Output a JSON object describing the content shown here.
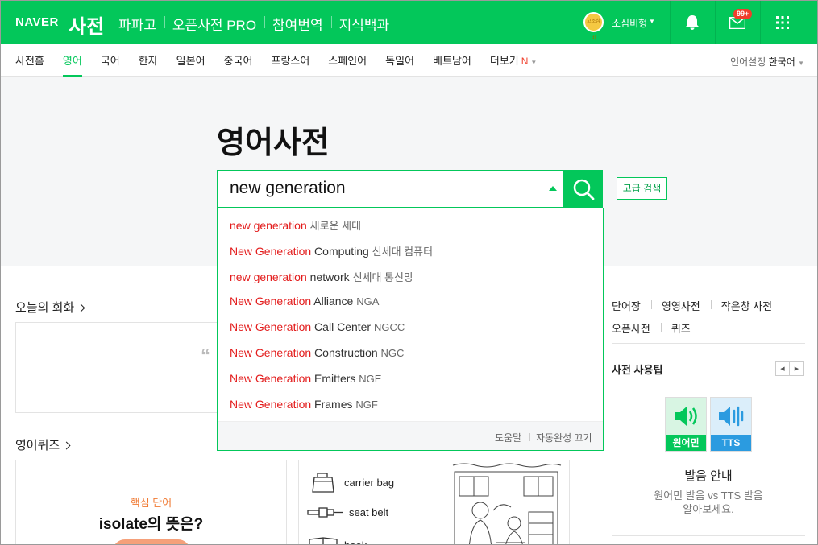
{
  "header": {
    "naver": "NAVER",
    "service": "사전",
    "nav": [
      "파파고",
      "오픈사전 PRO",
      "참여번역",
      "지식백과"
    ],
    "avatar_text": "고소심비",
    "username": "소심비형",
    "mail_badge": "99+"
  },
  "subnav": {
    "items": [
      "사전홈",
      "영어",
      "국어",
      "한자",
      "일본어",
      "중국어",
      "프랑스어",
      "스페인어",
      "독일어",
      "베트남어"
    ],
    "more": "더보기",
    "new_mark": "N",
    "lang_label": "언어설정",
    "lang_value": "한국어"
  },
  "hero": {
    "title": "영어사전",
    "query": "new generation",
    "advanced": "고급 검색"
  },
  "autocomplete": {
    "items": [
      {
        "m": "new generation",
        "rest": "",
        "ko": "새로운 세대"
      },
      {
        "m": "New Generation",
        "rest": " Computing",
        "ko": "신세대 컴퓨터"
      },
      {
        "m": "new generation",
        "rest": " network",
        "ko": "신세대 통신망"
      },
      {
        "m": "New Generation",
        "rest": " Alliance",
        "ko": "NGA"
      },
      {
        "m": "New Generation",
        "rest": " Call Center",
        "ko": "NGCC"
      },
      {
        "m": "New Generation",
        "rest": " Construction",
        "ko": "NGC"
      },
      {
        "m": "New Generation",
        "rest": " Emitters",
        "ko": "NGE"
      },
      {
        "m": "New Generation",
        "rest": " Frames",
        "ko": "NGF"
      }
    ],
    "help": "도움말",
    "autocomplete_off": "자동완성 끄기"
  },
  "sections": {
    "today_conversation": "오늘의 회화",
    "quote": "“",
    "quiz": "영어퀴즈"
  },
  "quiz_card": {
    "tag": "핵심 단어",
    "question": "isolate의 뜻은?"
  },
  "picture_words": [
    "carrier bag",
    "seat belt",
    "book"
  ],
  "right": {
    "links_row1": [
      "단어장",
      "영영사전",
      "작은창 사전"
    ],
    "links_row2": [
      "오픈사전",
      "퀴즈"
    ],
    "tip_title": "사전 사용팁",
    "native_label": "원어민",
    "tts_label": "TTS",
    "tip_sub": "발음 안내",
    "tip_desc1": "원어민 발음 vs TTS 발음",
    "tip_desc2": "알아보세요."
  },
  "colors": {
    "brand": "#03c75a",
    "highlight": "#e31c1c",
    "badge": "#f03e2b"
  }
}
